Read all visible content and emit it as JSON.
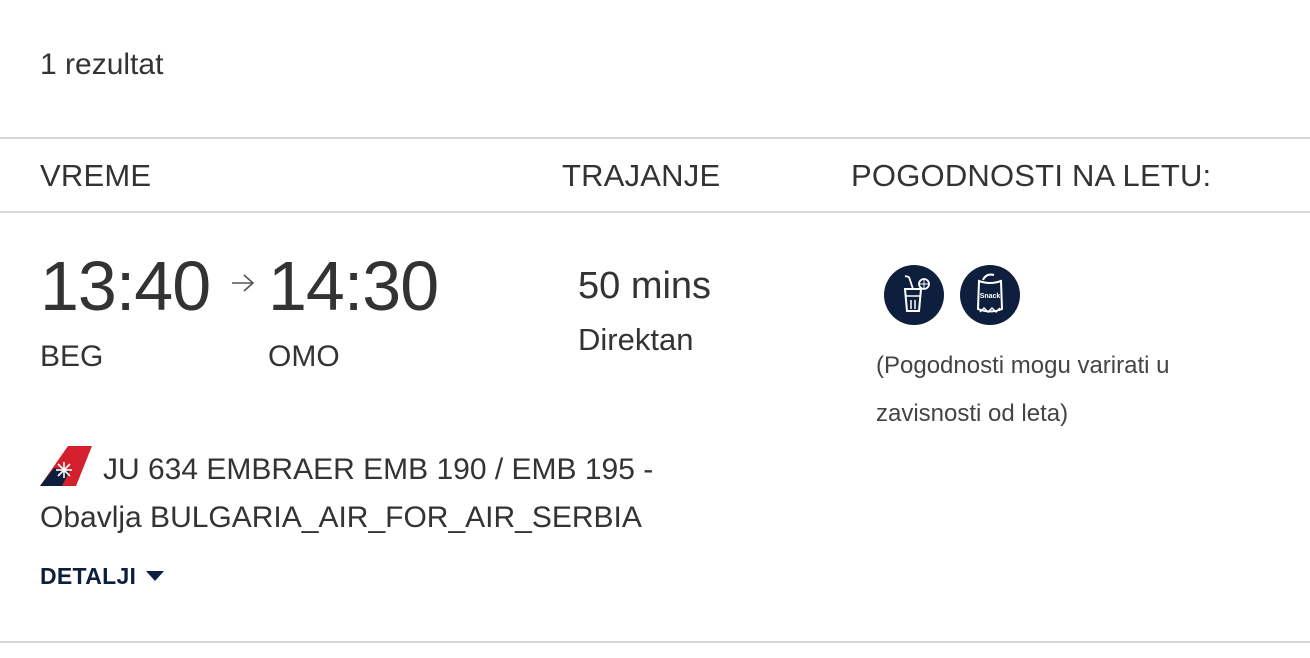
{
  "results": {
    "count_label": "1 rezultat"
  },
  "columns": {
    "time": "VREME",
    "duration": "TRAJANJE",
    "amenities": "POGODNOSTI NA LETU:"
  },
  "flight": {
    "departure_time": "13:40",
    "arrival_time": "14:30",
    "departure_airport": "BEG",
    "arrival_airport": "OMO",
    "duration": "50 mins",
    "stops": "Direktan",
    "flight_number": "JU 634",
    "aircraft": "EMBRAER EMB 190 / EMB 195",
    "separator": "-",
    "operated_by": "Obavlja BULGARIA_AIR_FOR_AIR_SERBIA",
    "details_label": "DETALJI"
  },
  "amenities": {
    "icons": [
      "drink-icon",
      "snack-icon"
    ],
    "snack_label": "Snack",
    "note": "(Pogodnosti mogu varirati u zavisnosti od leta)"
  },
  "colors": {
    "navy": "#0d1f3c",
    "text": "#333333",
    "divider": "#d6d6d6",
    "airline_red": "#d4202c"
  }
}
